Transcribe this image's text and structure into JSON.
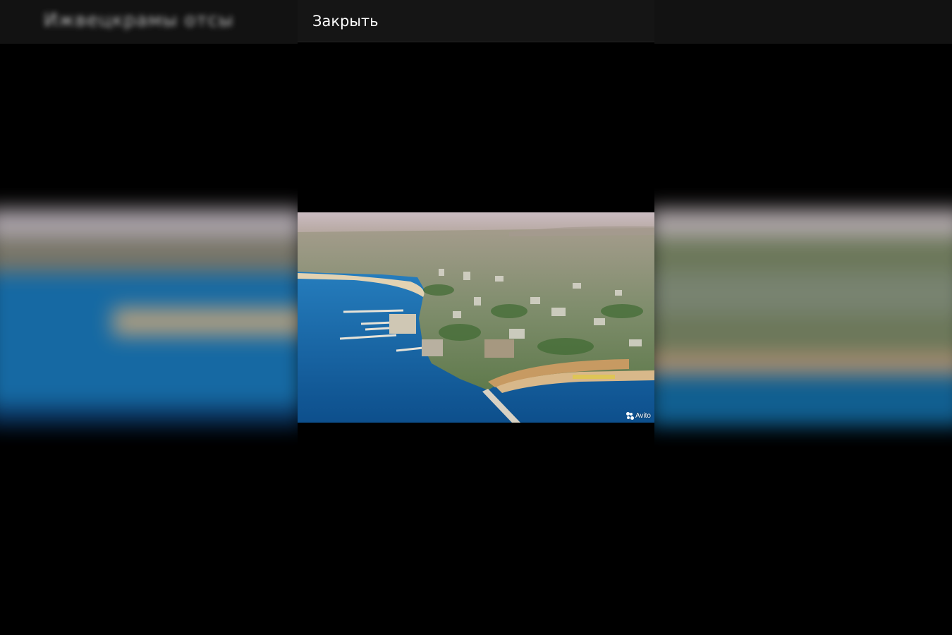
{
  "background": {
    "title": "Ижвецкрамы отсы",
    "header_color": "#161616"
  },
  "viewer": {
    "close_label": "Закрыть",
    "photo": {
      "subject": "aerial-coastal-city",
      "watermark": "Avito",
      "colors": {
        "sea": "#1c78b8",
        "sky": "#c9b9bd",
        "city": "#8a9a7c"
      }
    }
  }
}
